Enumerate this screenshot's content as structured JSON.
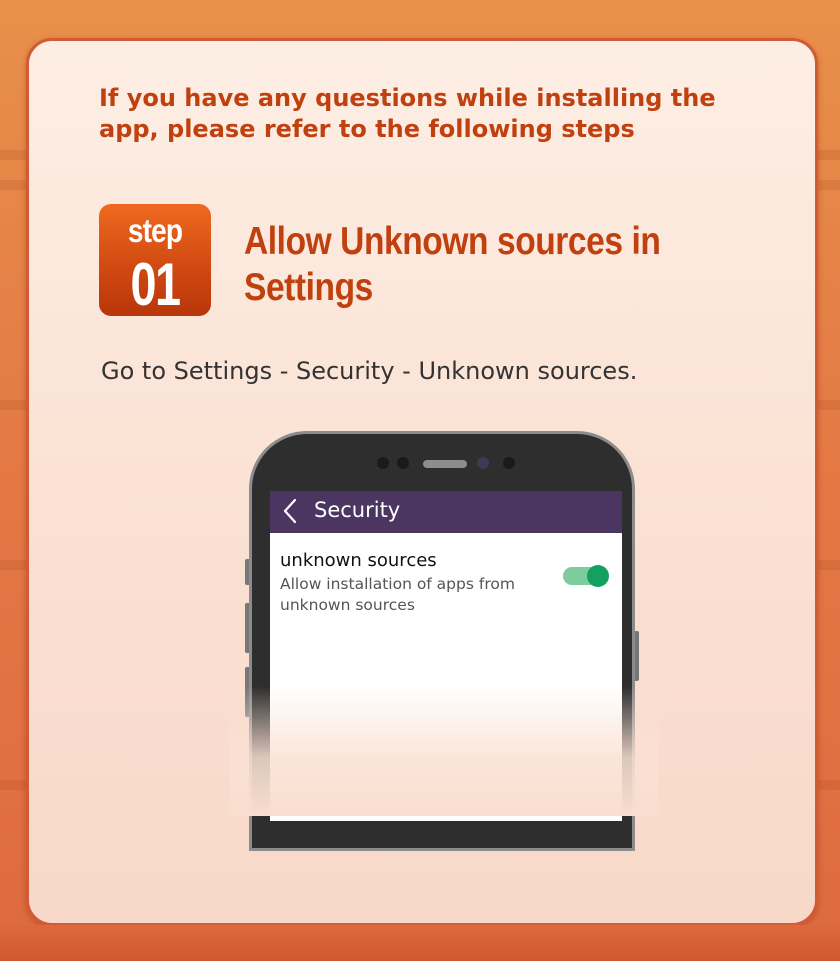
{
  "intro_text": "If you have any questions while installing the app, please refer to the following steps",
  "step": {
    "word": "step",
    "number": "01",
    "title": "Allow Unknown sources in Settings"
  },
  "instructions": "Go to Settings - Security - Unknown sources.",
  "phone": {
    "app_bar_title": "Security",
    "back_icon": "chevron-left-icon",
    "setting": {
      "title": "unknown sources",
      "description": "Allow installation of apps from unknown sources",
      "toggle_on": true
    }
  },
  "colors": {
    "accent": "#c0410f",
    "badge": "#d24a12",
    "app_bar": "#4a3660",
    "toggle": "#13a060"
  }
}
